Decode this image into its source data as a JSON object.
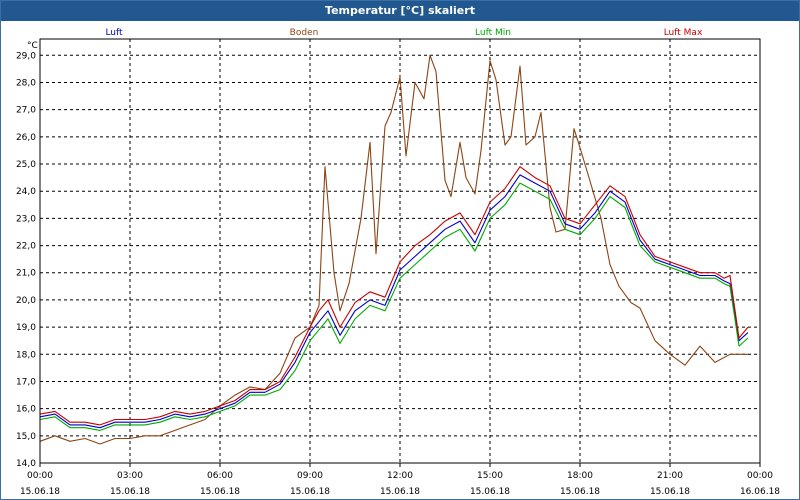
{
  "window": {
    "title": "Temperatur [°C] skaliert"
  },
  "chart_data": {
    "type": "line",
    "title": "Temperatur [°C] skaliert",
    "ylabel": "°C",
    "xlabel": "",
    "ylim": [
      14.0,
      29.6
    ],
    "xlim": [
      0,
      24
    ],
    "grid": true,
    "legend_position": "top",
    "y_ticks": [
      "14,0",
      "15,0",
      "16,0",
      "17,0",
      "18,0",
      "19,0",
      "20,0",
      "21,0",
      "22,0",
      "23,0",
      "24,0",
      "25,0",
      "26,0",
      "27,0",
      "28,0",
      "29,0"
    ],
    "x_tick_times": [
      "00:00",
      "03:00",
      "06:00",
      "09:00",
      "12:00",
      "15:00",
      "18:00",
      "21:00",
      "00:00"
    ],
    "x_tick_dates": [
      "15.06.18",
      "15.06.18",
      "15.06.18",
      "15.06.18",
      "15.06.18",
      "15.06.18",
      "15.06.18",
      "15.06.18",
      "16.06.18"
    ],
    "x_unit": "hours since 15.06.18 00:00",
    "series": [
      {
        "name": "Luft",
        "color": "#0000c8",
        "x": [
          0,
          0.5,
          1,
          1.5,
          2,
          2.5,
          3,
          3.5,
          4,
          4.5,
          5,
          5.5,
          6,
          6.5,
          7,
          7.5,
          8,
          8.5,
          9,
          9.3,
          9.6,
          10,
          10.5,
          11,
          11.5,
          12,
          12.5,
          13,
          13.5,
          14,
          14.5,
          15,
          15.5,
          16,
          16.5,
          17,
          17.5,
          18,
          18.5,
          19,
          19.5,
          20,
          20.5,
          21,
          21.5,
          22,
          22.5,
          22.8,
          23,
          23.3,
          23.6
        ],
        "y": [
          15.7,
          15.8,
          15.4,
          15.4,
          15.3,
          15.5,
          15.5,
          15.5,
          15.6,
          15.8,
          15.7,
          15.8,
          16.0,
          16.2,
          16.6,
          16.6,
          16.9,
          17.7,
          18.8,
          19.2,
          19.6,
          18.7,
          19.6,
          20.0,
          19.8,
          21.1,
          21.6,
          22.1,
          22.6,
          22.9,
          22.1,
          23.3,
          23.8,
          24.6,
          24.3,
          24.0,
          22.8,
          22.6,
          23.2,
          24.0,
          23.6,
          22.2,
          21.5,
          21.3,
          21.1,
          20.9,
          20.9,
          20.7,
          20.6,
          18.5,
          18.8
        ]
      },
      {
        "name": "Boden",
        "color": "#8b4513",
        "x": [
          0,
          0.5,
          1,
          1.5,
          2,
          2.5,
          3,
          3.5,
          4,
          4.5,
          5,
          5.5,
          6,
          6.5,
          7,
          7.5,
          8,
          8.5,
          9,
          9.3,
          9.5,
          9.8,
          10,
          10.3,
          10.7,
          11,
          11.2,
          11.5,
          11.7,
          12,
          12.2,
          12.5,
          12.8,
          13,
          13.2,
          13.5,
          13.7,
          14,
          14.2,
          14.5,
          14.7,
          15,
          15.2,
          15.5,
          15.7,
          16,
          16.2,
          16.5,
          16.7,
          17,
          17.2,
          17.5,
          17.8,
          18,
          18.3,
          18.7,
          19,
          19.3,
          19.7,
          20,
          20.5,
          21,
          21.5,
          22,
          22.5,
          23,
          23.6
        ],
        "y": [
          14.8,
          15.0,
          14.8,
          14.9,
          14.7,
          14.9,
          14.9,
          15.0,
          15.0,
          15.2,
          15.4,
          15.6,
          16.1,
          16.5,
          16.8,
          16.7,
          17.3,
          18.6,
          19.0,
          19.8,
          24.9,
          21.0,
          19.6,
          20.6,
          23.0,
          25.8,
          21.7,
          26.4,
          26.9,
          28.2,
          25.3,
          28.0,
          27.4,
          29.0,
          28.4,
          24.4,
          23.8,
          25.8,
          24.5,
          23.9,
          25.5,
          28.8,
          28.1,
          25.7,
          26.0,
          28.6,
          25.7,
          26.0,
          26.9,
          23.4,
          22.5,
          22.6,
          26.3,
          25.6,
          24.5,
          23.0,
          21.3,
          20.5,
          19.9,
          19.7,
          18.5,
          18.0,
          17.6,
          18.3,
          17.7,
          18.0,
          18.0
        ]
      },
      {
        "name": "Luft Min",
        "color": "#00aa00",
        "x": [
          0,
          0.5,
          1,
          1.5,
          2,
          2.5,
          3,
          3.5,
          4,
          4.5,
          5,
          5.5,
          6,
          6.5,
          7,
          7.5,
          8,
          8.5,
          9,
          9.3,
          9.6,
          10,
          10.5,
          11,
          11.5,
          12,
          12.5,
          13,
          13.5,
          14,
          14.5,
          15,
          15.5,
          16,
          16.5,
          17,
          17.5,
          18,
          18.5,
          19,
          19.5,
          20,
          20.5,
          21,
          21.5,
          22,
          22.5,
          22.8,
          23,
          23.3,
          23.6
        ],
        "y": [
          15.6,
          15.7,
          15.3,
          15.3,
          15.2,
          15.4,
          15.4,
          15.4,
          15.5,
          15.7,
          15.6,
          15.7,
          15.9,
          16.1,
          16.5,
          16.5,
          16.7,
          17.4,
          18.5,
          18.9,
          19.3,
          18.4,
          19.3,
          19.8,
          19.6,
          20.8,
          21.3,
          21.8,
          22.3,
          22.6,
          21.8,
          23.0,
          23.5,
          24.3,
          24.0,
          23.7,
          22.6,
          22.4,
          23.0,
          23.8,
          23.4,
          22.0,
          21.4,
          21.2,
          21.0,
          20.8,
          20.8,
          20.6,
          20.5,
          18.3,
          18.6
        ]
      },
      {
        "name": "Luft Max",
        "color": "#c80000",
        "x": [
          0,
          0.5,
          1,
          1.5,
          2,
          2.5,
          3,
          3.5,
          4,
          4.5,
          5,
          5.5,
          6,
          6.5,
          7,
          7.5,
          8,
          8.5,
          9,
          9.3,
          9.6,
          10,
          10.5,
          11,
          11.5,
          12,
          12.5,
          13,
          13.5,
          14,
          14.5,
          15,
          15.5,
          16,
          16.5,
          17,
          17.5,
          18,
          18.5,
          19,
          19.5,
          20,
          20.5,
          21,
          21.5,
          22,
          22.5,
          22.8,
          23,
          23.3,
          23.6
        ],
        "y": [
          15.8,
          15.9,
          15.5,
          15.5,
          15.4,
          15.6,
          15.6,
          15.6,
          15.7,
          15.9,
          15.8,
          15.9,
          16.1,
          16.3,
          16.7,
          16.7,
          17.0,
          17.9,
          19.0,
          19.6,
          20.0,
          19.0,
          19.9,
          20.3,
          20.1,
          21.4,
          22.0,
          22.4,
          22.9,
          23.2,
          22.4,
          23.6,
          24.1,
          24.9,
          24.5,
          24.2,
          23.0,
          22.8,
          23.5,
          24.2,
          23.8,
          22.4,
          21.6,
          21.4,
          21.2,
          21.0,
          21.0,
          20.8,
          20.9,
          18.6,
          19.0
        ]
      }
    ]
  }
}
